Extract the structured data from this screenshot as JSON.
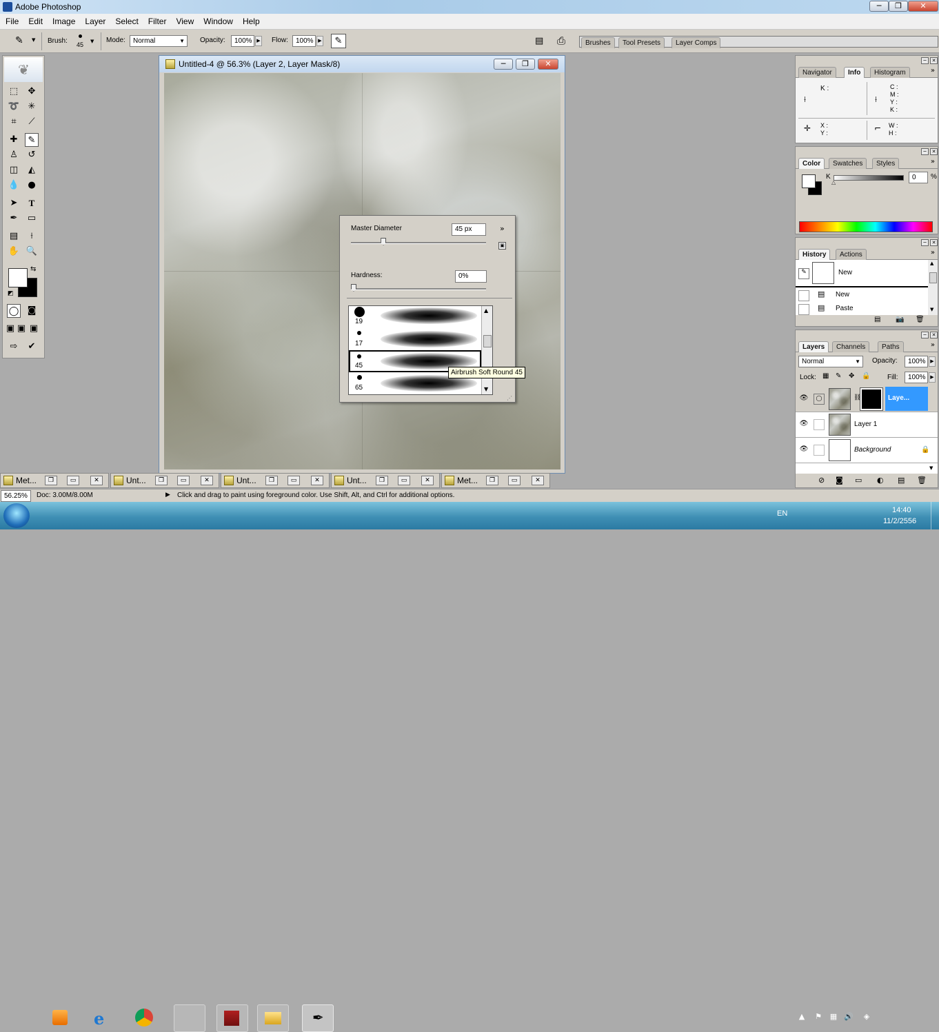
{
  "window": {
    "title": "Adobe Photoshop"
  },
  "menu": [
    "File",
    "Edit",
    "Image",
    "Layer",
    "Select",
    "Filter",
    "View",
    "Window",
    "Help"
  ],
  "options": {
    "brush_label": "Brush:",
    "brush_size": "45",
    "mode_label": "Mode:",
    "mode_value": "Normal",
    "opacity_label": "Opacity:",
    "opacity_value": "100%",
    "flow_label": "Flow:",
    "flow_value": "100%",
    "well_tabs": [
      "Brushes",
      "Tool Presets",
      "Layer Comps"
    ]
  },
  "document": {
    "title": "Untitled-4 @ 56.3% (Layer 2, Layer Mask/8)"
  },
  "brush_picker": {
    "master_label": "Master Diameter",
    "master_value": "45 px",
    "master_fraction": 0.22,
    "hardness_label": "Hardness:",
    "hardness_value": "0%",
    "hardness_fraction": 0.0,
    "presets": [
      {
        "size": "19"
      },
      {
        "size": "17"
      },
      {
        "size": "45"
      },
      {
        "size": "65"
      }
    ],
    "tooltip": "Airbrush Soft Round 45"
  },
  "nav_panel": {
    "tabs": [
      "Navigator",
      "Info",
      "Histogram"
    ],
    "k_label": "K :",
    "cmyk": [
      "C :",
      "M :",
      "Y :",
      "K :"
    ],
    "xy": [
      "X :",
      "Y :"
    ],
    "wh": [
      "W :",
      "H :"
    ]
  },
  "color_panel": {
    "tabs": [
      "Color",
      "Swatches",
      "Styles"
    ],
    "channel": "K",
    "value": "0",
    "unit": "%"
  },
  "history_panel": {
    "tabs": [
      "History",
      "Actions"
    ],
    "snapshot": "New",
    "items": [
      "New",
      "Paste"
    ]
  },
  "layers_panel": {
    "tabs": [
      "Layers",
      "Channels",
      "Paths"
    ],
    "blend": "Normal",
    "opacity_label": "Opacity:",
    "opacity_value": "100%",
    "lock_label": "Lock:",
    "fill_label": "Fill:",
    "fill_value": "100%",
    "layers": [
      {
        "name": "Laye..."
      },
      {
        "name": "Layer 1"
      },
      {
        "name": "Background"
      }
    ]
  },
  "doc_tabs": [
    "Met...",
    "Unt...",
    "Unt...",
    "Unt...",
    "Met..."
  ],
  "status": {
    "zoom": "56.25%",
    "doc": "Doc: 3.00M/8.00M",
    "hint": "Click and drag to paint using foreground color.  Use Shift, Alt, and Ctrl for additional options."
  },
  "tray": {
    "lang": "EN",
    "time": "14:40",
    "date": "11/2/2556"
  },
  "colors": {
    "titlebar": "#b9d1ea",
    "workspace": "#ababab",
    "panel": "#d4d0c8",
    "layer_selected": "#3399ff",
    "taskbar": "#5aa9c9"
  }
}
